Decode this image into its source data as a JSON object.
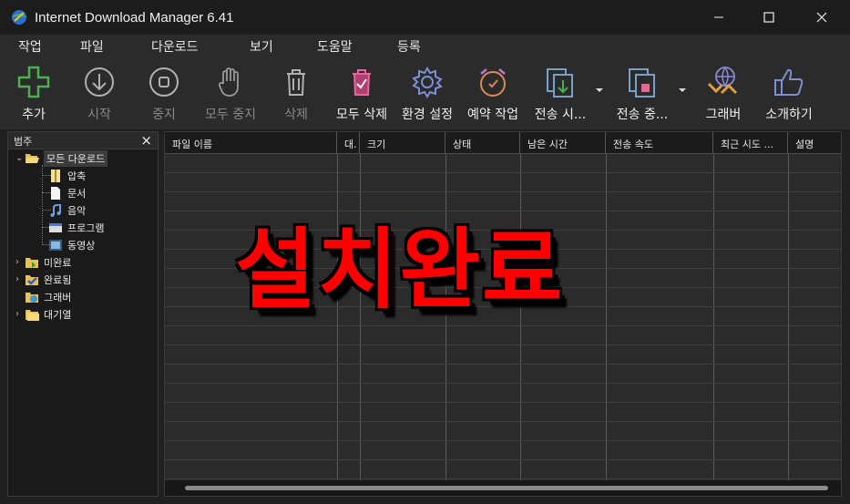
{
  "window": {
    "title": "Internet Download Manager 6.41"
  },
  "menu": [
    "작업",
    "파일",
    "다운로드",
    "보기",
    "도움말",
    "등록"
  ],
  "toolbar": {
    "add": "추가",
    "start": "시작",
    "stop": "중지",
    "stop_all": "모두 중지",
    "delete": "삭제",
    "delete_all": "모두 삭제",
    "settings": "환경 설정",
    "scheduler": "예약 작업",
    "start_queue": "전송 시...",
    "stop_queue": "전송 중...",
    "grabber": "그래버",
    "tell_friend": "소개하기"
  },
  "categories": {
    "header": "범주",
    "close": "×",
    "items": [
      {
        "label": "모든 다운로드",
        "icon": "folder-open-icon"
      },
      {
        "label": "압축",
        "icon": "archive-icon"
      },
      {
        "label": "문서",
        "icon": "document-icon"
      },
      {
        "label": "음악",
        "icon": "music-icon"
      },
      {
        "label": "프로그램",
        "icon": "program-icon"
      },
      {
        "label": "동영상",
        "icon": "video-icon"
      },
      {
        "label": "미완료",
        "icon": "folder-unfinished-icon"
      },
      {
        "label": "완료됨",
        "icon": "folder-finished-icon"
      },
      {
        "label": "그래버",
        "icon": "folder-grabber-icon"
      },
      {
        "label": "대기열",
        "icon": "folder-queue-icon"
      }
    ]
  },
  "columns": [
    "파일 이름",
    "대.",
    "크기",
    "상태",
    "남은 시간",
    "전송 속도",
    "최근 시도 ...",
    "설명"
  ],
  "overlay_text": "설치완료",
  "colors": {
    "accent_green": "#4caf50",
    "overlay_red": "#ff0000",
    "background": "#2b2b2b"
  }
}
